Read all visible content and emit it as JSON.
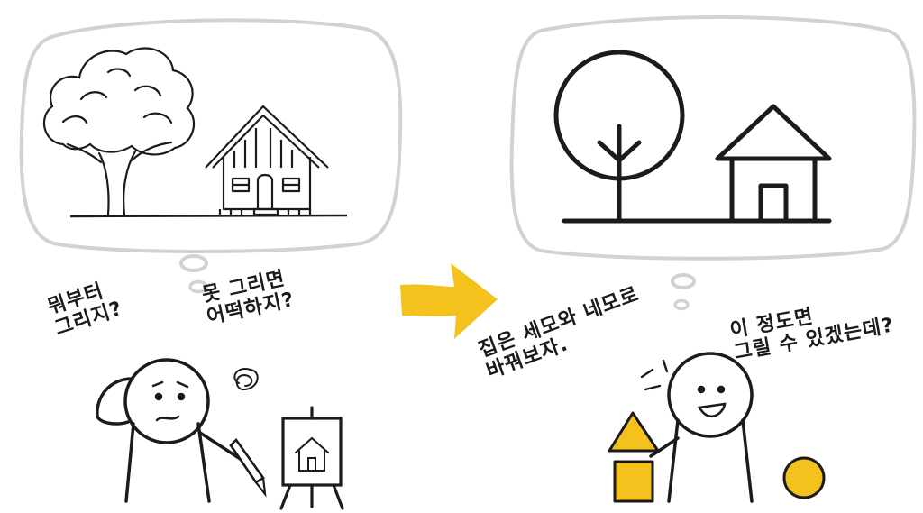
{
  "left_panel": {
    "question_1": "뭐부터\n그리지?",
    "question_2": "못 그리면\n어떡하지?"
  },
  "right_panel": {
    "speech_1": "집은 세모와 네모로\n바꿔보자.",
    "speech_2": "이 정도면\n그릴 수 있겠는데?"
  },
  "colors": {
    "accent_yellow": "#f3c21d",
    "ink": "#1b1b1b",
    "bubble_outline": "#d2d2d2"
  }
}
